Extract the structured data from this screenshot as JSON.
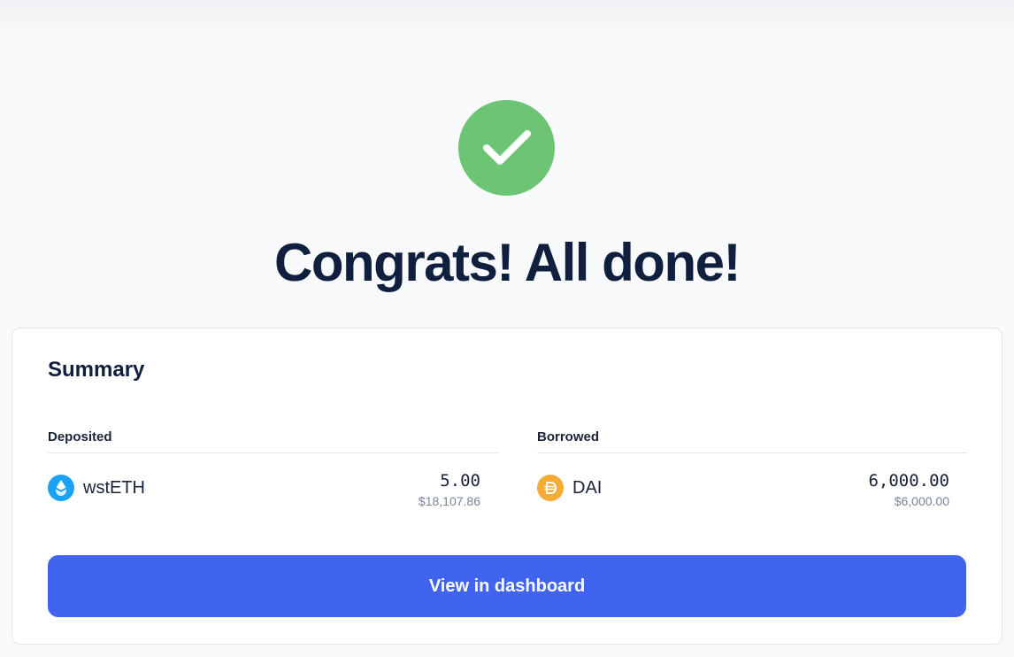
{
  "headline": "Congrats! All done!",
  "colors": {
    "success": "#6dc475",
    "primary": "#4064ee",
    "wsteth": "#1aa3f5",
    "dai": "#f5ac37"
  },
  "summary": {
    "title": "Summary",
    "deposited": {
      "header": "Deposited",
      "asset": {
        "icon": "wsteth-token-icon",
        "name": "wstETH",
        "amount": "5.00",
        "usd": "$18,107.86"
      }
    },
    "borrowed": {
      "header": "Borrowed",
      "asset": {
        "icon": "dai-token-icon",
        "name": "DAI",
        "amount": "6,000.00",
        "usd": "$6,000.00"
      }
    },
    "button_label": "View in dashboard"
  }
}
